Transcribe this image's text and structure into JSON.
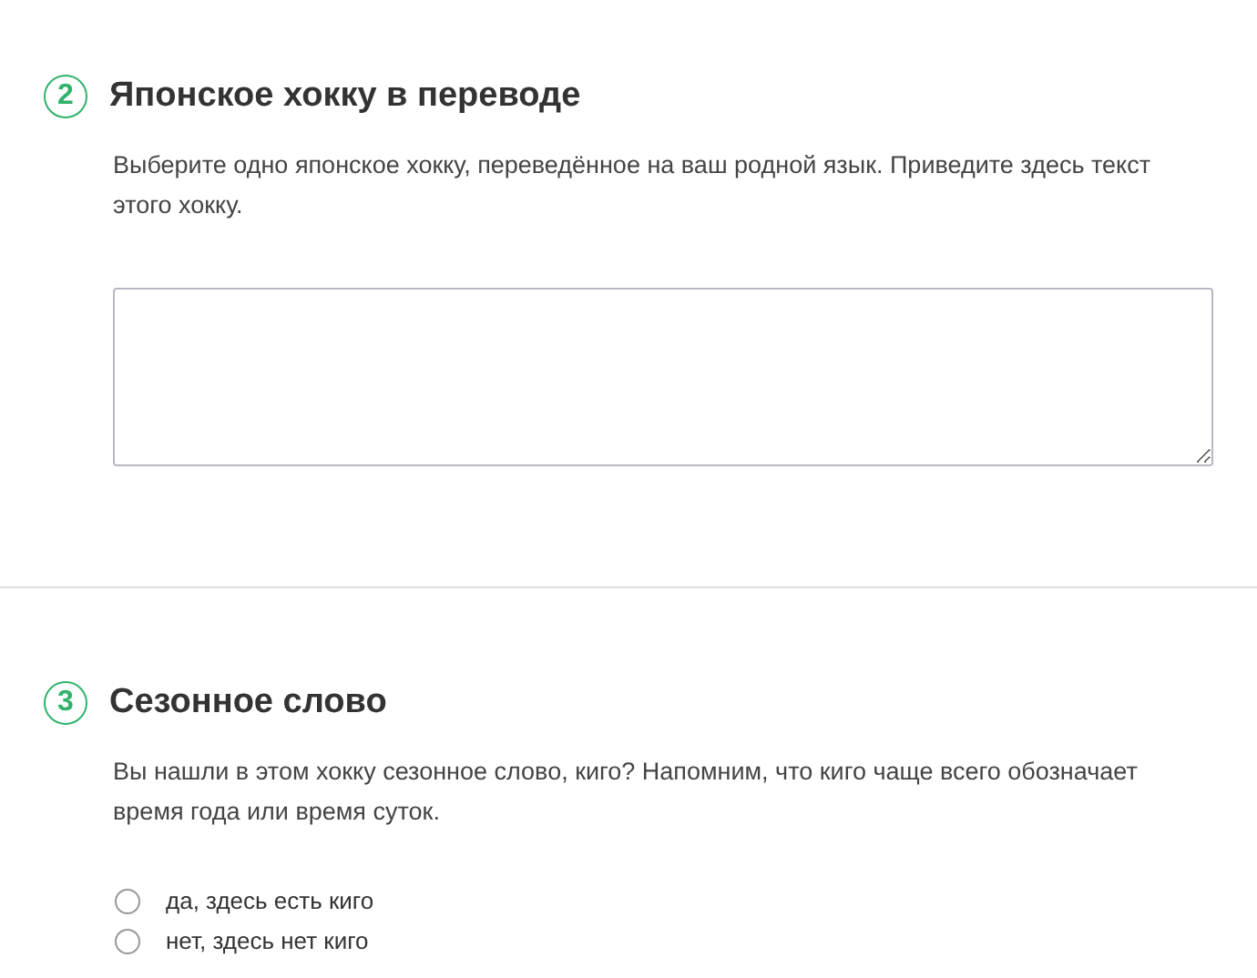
{
  "questions": [
    {
      "number": "2",
      "title": "Японское хокку в переводе",
      "description": "Выберите одно японское хокку, переведённое на ваш родной язык. Приведите здесь текст этого хокку.",
      "kind": "textarea"
    },
    {
      "number": "3",
      "title": "Сезонное слово",
      "description": "Вы нашли в этом хокку сезонное слово, киго? Напомним, что киго чаще всего обозначает время года или время суток.",
      "kind": "radio",
      "options": [
        {
          "label": "да, здесь есть киго",
          "selected": false
        },
        {
          "label": "нет, здесь нет киго",
          "selected": false
        }
      ]
    }
  ]
}
